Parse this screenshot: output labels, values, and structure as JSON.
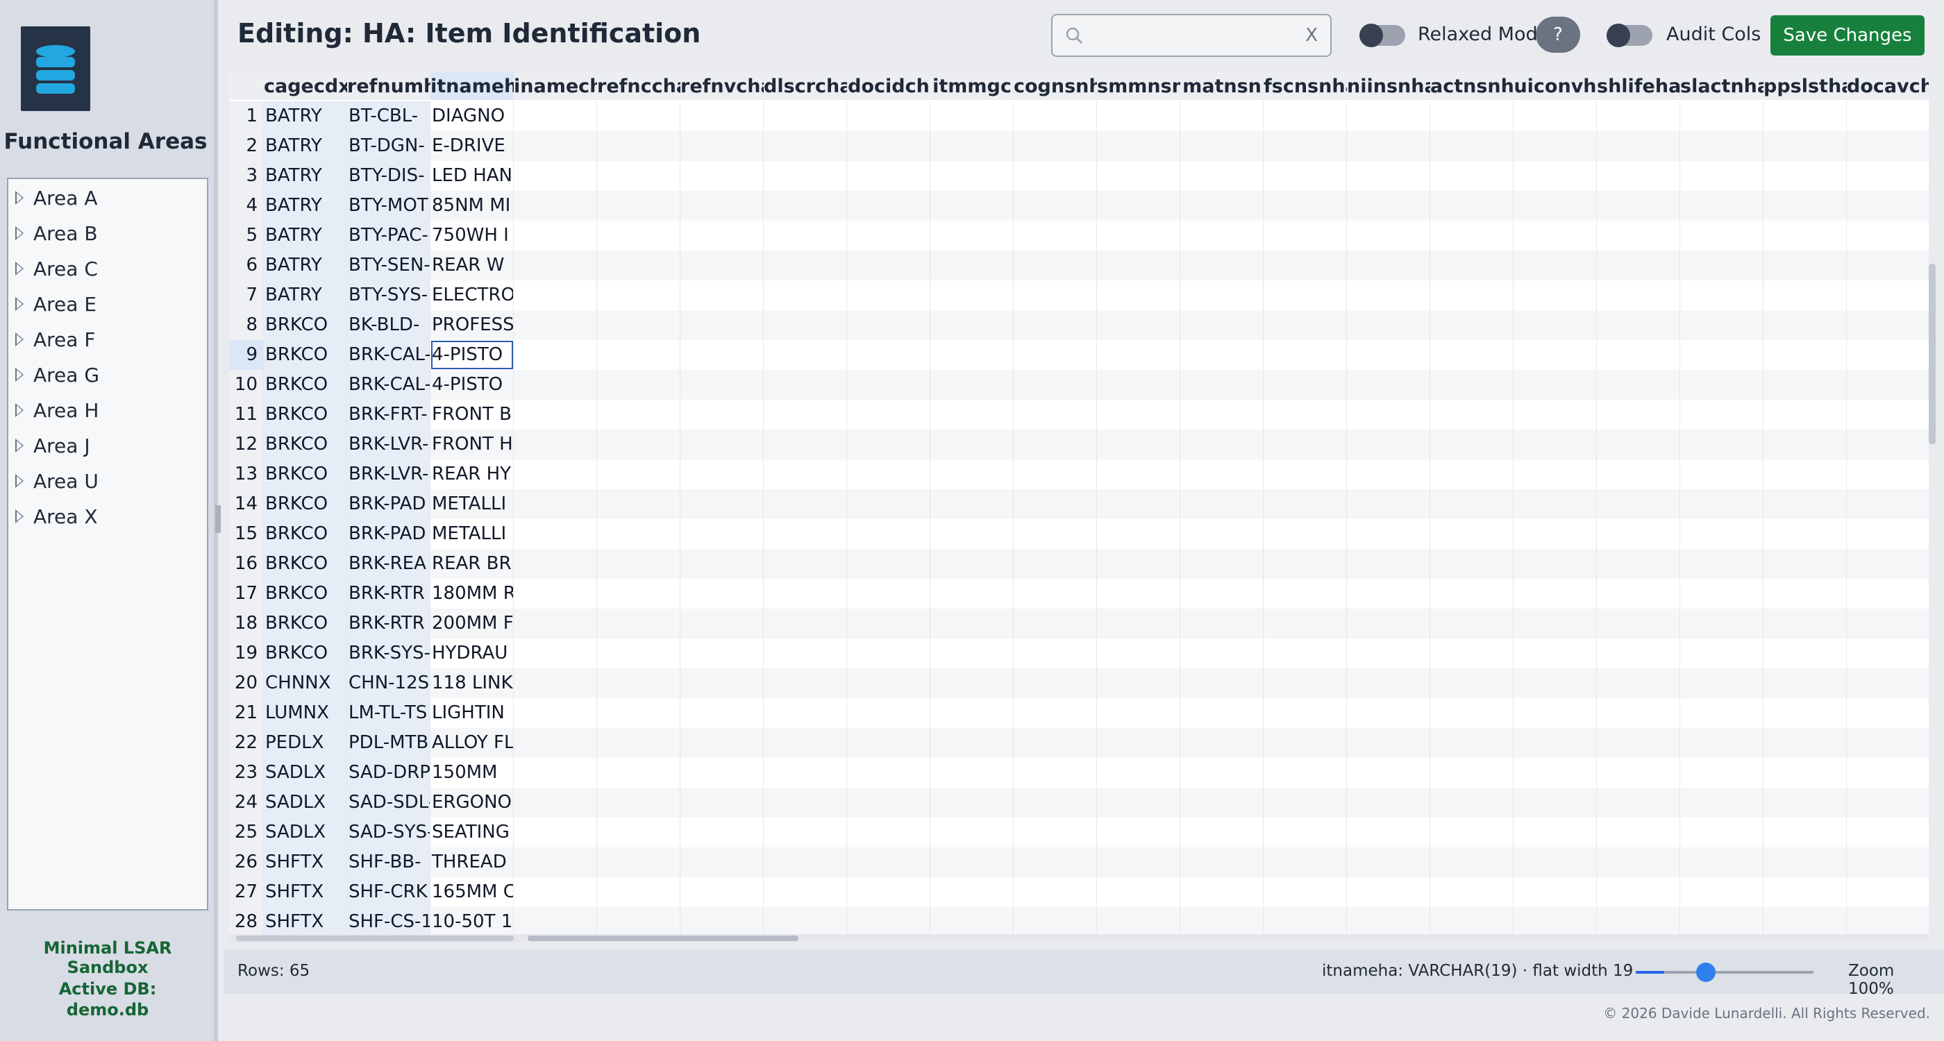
{
  "sidebar": {
    "title": "Functional Areas",
    "areas": [
      "Area A",
      "Area B",
      "Area C",
      "Area E",
      "Area F",
      "Area G",
      "Area H",
      "Area J",
      "Area U",
      "Area X"
    ],
    "sandbox_label": "Minimal LSAR Sandbox",
    "active_db_label": "Active DB:",
    "active_db_value": "demo.db"
  },
  "header": {
    "title": "Editing: HA: Item Identification",
    "search_placeholder": "",
    "search_clear": "X",
    "relaxed_mode_label": "Relaxed Mode",
    "help_label": "?",
    "audit_cols_label": "Audit Cols",
    "save_label": "Save Changes"
  },
  "grid": {
    "columns": [
      "cagecdx",
      "refnumh",
      "itnameh",
      "inamech",
      "refnccha",
      "refnvcha",
      "dlscrcha",
      "docidch",
      "itmmgc",
      "cognsnh",
      "smmnsn",
      "matnsn",
      "fscnsnha",
      "niinsnha",
      "actnsnh",
      "uiconvh",
      "shlifeha",
      "slactnha",
      "ppslstha",
      "docavch"
    ],
    "selected_column": "itnameh",
    "selected_row": 9,
    "rows": [
      [
        "BATRY",
        "BT-CBL-",
        "DIAGNO"
      ],
      [
        "BATRY",
        "BT-DGN-",
        "E-DRIVE"
      ],
      [
        "BATRY",
        "BTY-DIS-",
        "LED HAN"
      ],
      [
        "BATRY",
        "BTY-MOT",
        "85NM MI"
      ],
      [
        "BATRY",
        "BTY-PAC-",
        "750WH I"
      ],
      [
        "BATRY",
        "BTY-SEN-",
        "REAR W"
      ],
      [
        "BATRY",
        "BTY-SYS-",
        "ELECTRO"
      ],
      [
        "BRKCO",
        "BK-BLD-",
        "PROFESS"
      ],
      [
        "BRKCO",
        "BRK-CAL-",
        "4-PISTO"
      ],
      [
        "BRKCO",
        "BRK-CAL-",
        "4-PISTO"
      ],
      [
        "BRKCO",
        "BRK-FRT-",
        "FRONT B"
      ],
      [
        "BRKCO",
        "BRK-LVR-",
        "FRONT H"
      ],
      [
        "BRKCO",
        "BRK-LVR-",
        "REAR HY"
      ],
      [
        "BRKCO",
        "BRK-PAD",
        "METALLI"
      ],
      [
        "BRKCO",
        "BRK-PAD",
        "METALLI"
      ],
      [
        "BRKCO",
        "BRK-REA",
        "REAR BR"
      ],
      [
        "BRKCO",
        "BRK-RTR",
        "180MM R"
      ],
      [
        "BRKCO",
        "BRK-RTR",
        "200MM F"
      ],
      [
        "BRKCO",
        "BRK-SYS-",
        "HYDRAU"
      ],
      [
        "CHNNX",
        "CHN-12S",
        "118 LINK"
      ],
      [
        "LUMNX",
        "LM-TL-TS",
        "LIGHTIN"
      ],
      [
        "PEDLX",
        "PDL-MTB",
        "ALLOY FL"
      ],
      [
        "SADLX",
        "SAD-DRP",
        "150MM"
      ],
      [
        "SADLX",
        "SAD-SDL-",
        "ERGONO"
      ],
      [
        "SADLX",
        "SAD-SYS-",
        "SEATING"
      ],
      [
        "SHFTX",
        "SHF-BB-",
        "THREAD"
      ],
      [
        "SHFTX",
        "SHF-CRK",
        "165MM C"
      ],
      [
        "SHFTX",
        "SHF-CS-1",
        "10-50T 1"
      ]
    ]
  },
  "status": {
    "rows_count": "Rows: 65",
    "column_info": "itnameha:  VARCHAR(19)  ·  flat width 19",
    "zoom_label": "Zoom 100%",
    "zoom_fraction": 0.16
  },
  "footer": "© 2026 Davide Lunardelli. All Rights Reserved.",
  "colors": {
    "save_button": "#17803d",
    "accent_text": "#166534",
    "selection": "#dbe7f6",
    "focus_outline": "#2b5bb0"
  }
}
